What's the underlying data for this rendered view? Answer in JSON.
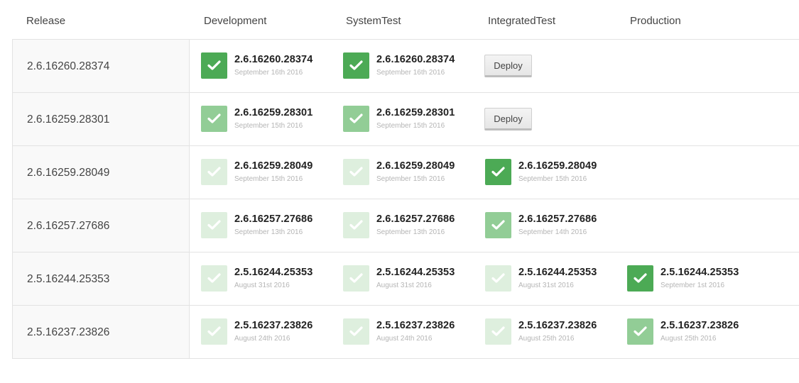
{
  "headers": {
    "release": "Release",
    "environments": [
      "Development",
      "SystemTest",
      "IntegratedTest",
      "Production"
    ]
  },
  "deploy_label": "Deploy",
  "colors": {
    "status_full": "#4caa55",
    "status_mid": "#92cd96",
    "status_light": "#deefde"
  },
  "icon": "checkmark-icon",
  "rows": [
    {
      "release": "2.6.16260.28374",
      "cells": [
        {
          "type": "deployed",
          "status": "full",
          "version": "2.6.16260.28374",
          "date": "September 16th 2016"
        },
        {
          "type": "deployed",
          "status": "full",
          "version": "2.6.16260.28374",
          "date": "September 16th 2016"
        },
        {
          "type": "deploy"
        },
        {
          "type": "empty"
        }
      ]
    },
    {
      "release": "2.6.16259.28301",
      "cells": [
        {
          "type": "deployed",
          "status": "mid",
          "version": "2.6.16259.28301",
          "date": "September 15th 2016"
        },
        {
          "type": "deployed",
          "status": "mid",
          "version": "2.6.16259.28301",
          "date": "September 15th 2016"
        },
        {
          "type": "deploy"
        },
        {
          "type": "empty"
        }
      ]
    },
    {
      "release": "2.6.16259.28049",
      "cells": [
        {
          "type": "deployed",
          "status": "light",
          "version": "2.6.16259.28049",
          "date": "September 15th 2016"
        },
        {
          "type": "deployed",
          "status": "light",
          "version": "2.6.16259.28049",
          "date": "September 15th 2016"
        },
        {
          "type": "deployed",
          "status": "full",
          "version": "2.6.16259.28049",
          "date": "September 15th 2016"
        },
        {
          "type": "empty"
        }
      ]
    },
    {
      "release": "2.6.16257.27686",
      "cells": [
        {
          "type": "deployed",
          "status": "light",
          "version": "2.6.16257.27686",
          "date": "September 13th 2016"
        },
        {
          "type": "deployed",
          "status": "light",
          "version": "2.6.16257.27686",
          "date": "September 13th 2016"
        },
        {
          "type": "deployed",
          "status": "mid",
          "version": "2.6.16257.27686",
          "date": "September 14th 2016"
        },
        {
          "type": "empty"
        }
      ]
    },
    {
      "release": "2.5.16244.25353",
      "cells": [
        {
          "type": "deployed",
          "status": "light",
          "version": "2.5.16244.25353",
          "date": "August 31st 2016"
        },
        {
          "type": "deployed",
          "status": "light",
          "version": "2.5.16244.25353",
          "date": "August 31st 2016"
        },
        {
          "type": "deployed",
          "status": "light",
          "version": "2.5.16244.25353",
          "date": "August 31st 2016"
        },
        {
          "type": "deployed",
          "status": "full",
          "version": "2.5.16244.25353",
          "date": "September 1st 2016"
        }
      ]
    },
    {
      "release": "2.5.16237.23826",
      "cells": [
        {
          "type": "deployed",
          "status": "light",
          "version": "2.5.16237.23826",
          "date": "August 24th 2016"
        },
        {
          "type": "deployed",
          "status": "light",
          "version": "2.5.16237.23826",
          "date": "August 24th 2016"
        },
        {
          "type": "deployed",
          "status": "light",
          "version": "2.5.16237.23826",
          "date": "August 25th 2016"
        },
        {
          "type": "deployed",
          "status": "mid",
          "version": "2.5.16237.23826",
          "date": "August 25th 2016"
        }
      ]
    }
  ]
}
